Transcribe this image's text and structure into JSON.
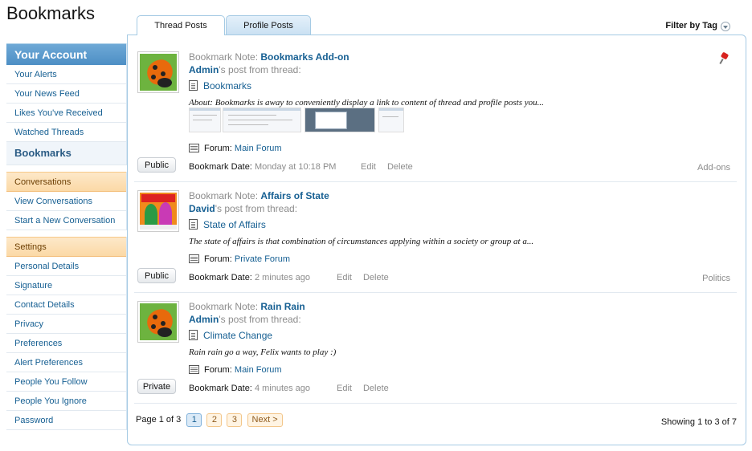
{
  "page": {
    "title": "Bookmarks"
  },
  "sidebar": {
    "account_header": "Your Account",
    "account_items": [
      {
        "label": "Your Alerts"
      },
      {
        "label": "Your News Feed"
      },
      {
        "label": "Likes You've Received"
      },
      {
        "label": "Watched Threads"
      },
      {
        "label": "Bookmarks",
        "active": true
      }
    ],
    "conversations_header": "Conversations",
    "conversation_items": [
      {
        "label": "View Conversations"
      },
      {
        "label": "Start a New Conversation"
      }
    ],
    "settings_header": "Settings",
    "settings_items": [
      {
        "label": "Personal Details"
      },
      {
        "label": "Signature"
      },
      {
        "label": "Contact Details"
      },
      {
        "label": "Privacy"
      },
      {
        "label": "Preferences"
      },
      {
        "label": "Alert Preferences"
      },
      {
        "label": "People You Follow"
      },
      {
        "label": "People You Ignore"
      },
      {
        "label": "Password"
      }
    ]
  },
  "tabs": [
    {
      "label": "Thread Posts",
      "active": true
    },
    {
      "label": "Profile Posts",
      "active": false
    }
  ],
  "filter_label": "Filter by Tag",
  "bookmarks": [
    {
      "note_prefix": "Bookmark Note:",
      "note_title": "Bookmarks Add-on",
      "user": "Admin",
      "from_suffix": "'s post from thread:",
      "thread": "Bookmarks",
      "excerpt": "About: Bookmarks is away to conveniently display a link to content of thread and profile posts you...",
      "forum_label": "Forum:",
      "forum": "Main Forum",
      "visibility": "Public",
      "date_label": "Bookmark Date:",
      "date": "Monday at 10:18 PM",
      "edit": "Edit",
      "delete": "Delete",
      "tag": "Add-ons",
      "pinned": true,
      "avatar": "ladybug-icon"
    },
    {
      "note_prefix": "Bookmark Note:",
      "note_title": "Affairs of State",
      "user": "David",
      "from_suffix": "'s post from thread:",
      "thread": "State of Affairs",
      "excerpt": "The state of affairs is that combination of circumstances applying within a society or group at a...",
      "forum_label": "Forum:",
      "forum": "Private Forum",
      "visibility": "Public",
      "date_label": "Bookmark Date:",
      "date": "2 minutes ago",
      "edit": "Edit",
      "delete": "Delete",
      "tag": "Politics",
      "avatar": "album-cover-icon"
    },
    {
      "note_prefix": "Bookmark Note:",
      "note_title": "Rain Rain",
      "user": "Admin",
      "from_suffix": "'s post from thread:",
      "thread": "Climate Change",
      "excerpt": "Rain rain go a way, Felix wants to play :)",
      "forum_label": "Forum:",
      "forum": "Main Forum",
      "visibility": "Private",
      "date_label": "Bookmark Date:",
      "date": "4 minutes ago",
      "edit": "Edit",
      "delete": "Delete",
      "tag": "",
      "avatar": "ladybug-icon"
    }
  ],
  "pager": {
    "label": "Page 1 of 3",
    "pages": [
      "1",
      "2",
      "3"
    ],
    "current": "1",
    "next": "Next >"
  },
  "showing": "Showing 1 to 3 of 7",
  "colors": {
    "link": "#176093",
    "sidebar_header": "#4d8fc5",
    "section_header": "#fbd9a6",
    "border": "#a5cae4"
  }
}
